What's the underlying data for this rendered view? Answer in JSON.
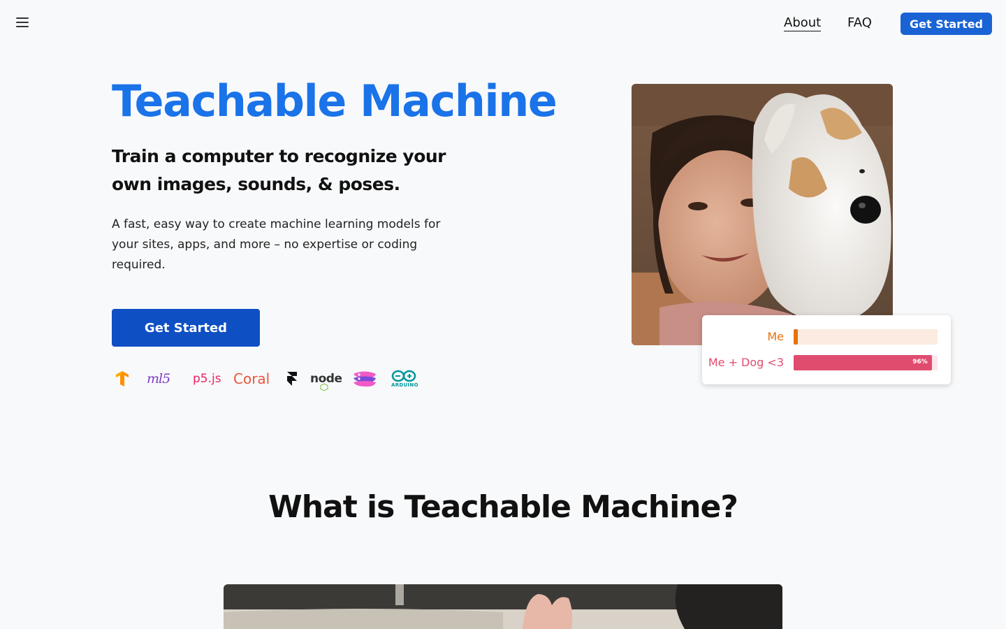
{
  "nav": {
    "about_label": "About",
    "faq_label": "FAQ",
    "cta_label": "Get Started"
  },
  "hero": {
    "title": "Teachable Machine",
    "subtitle": "Train a computer to recognize your own images, sounds, & poses.",
    "description": "A fast, easy way to create machine learning models for your sites, apps, and more – no expertise or coding required.",
    "cta_label": "Get Started",
    "logos": {
      "tensorflow": "tensorflow-icon",
      "ml5": "ml5",
      "p5": "p5.js",
      "coral": "Coral",
      "framer": "framer-icon",
      "node": "node",
      "glitch": "glitch-icon",
      "arduino": "ARDUINO"
    }
  },
  "demo": {
    "photo": "woman-with-plush-dog-photo",
    "results": [
      {
        "label": "Me",
        "value": 0.03,
        "color": "#e8710a",
        "track": "#fcebe0"
      },
      {
        "label": "Me + Dog <3",
        "value": 0.96,
        "pct_label": "96%",
        "color": "#e04c6e",
        "track": "#fbe6eb"
      }
    ]
  },
  "section": {
    "title": "What is Teachable Machine?"
  },
  "colors": {
    "accent": "#1a73e8",
    "button": "#0f4fc4",
    "background": "#f8f9fb"
  }
}
